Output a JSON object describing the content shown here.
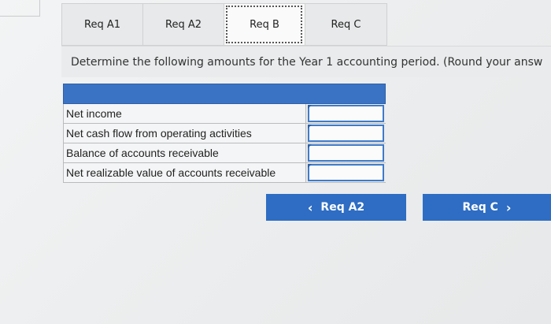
{
  "tabs": [
    {
      "label": "Req A1",
      "active": false
    },
    {
      "label": "Req A2",
      "active": false
    },
    {
      "label": "Req B",
      "active": true
    },
    {
      "label": "Req C",
      "active": false
    }
  ],
  "instruction": "Determine the following amounts for the Year 1 accounting period. (Round your answ",
  "table": {
    "rows": [
      {
        "label": "Net income",
        "value": ""
      },
      {
        "label": "Net cash flow from operating activities",
        "value": ""
      },
      {
        "label": "Balance of accounts receivable",
        "value": ""
      },
      {
        "label": "Net realizable value of accounts receivable",
        "value": ""
      }
    ]
  },
  "nav": {
    "prev_label": "Req A2",
    "prev_icon": "chevron-left-icon",
    "next_label": "Req C",
    "next_icon": "chevron-right-icon"
  },
  "colors": {
    "accent": "#2e6dc3",
    "header": "#3b73c4"
  }
}
